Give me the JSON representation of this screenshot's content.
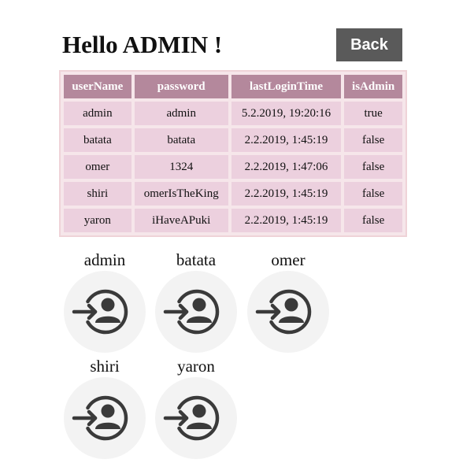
{
  "header": {
    "greeting": "Hello ADMIN !",
    "back_label": "Back"
  },
  "table": {
    "columns": [
      "userName",
      "password",
      "lastLoginTime",
      "isAdmin"
    ],
    "rows": [
      [
        "admin",
        "admin",
        "5.2.2019, 19:20:16",
        "true"
      ],
      [
        "batata",
        "batata",
        "2.2.2019, 1:45:19",
        "false"
      ],
      [
        "omer",
        "1324",
        "2.2.2019, 1:47:06",
        "false"
      ],
      [
        "shiri",
        "omerIsTheKing",
        "2.2.2019, 1:45:19",
        "false"
      ],
      [
        "yaron",
        "iHaveAPuki",
        "2.2.2019, 1:45:19",
        "false"
      ]
    ]
  },
  "tiles": [
    {
      "name": "admin",
      "icon": "login-user-icon"
    },
    {
      "name": "batata",
      "icon": "login-user-icon"
    },
    {
      "name": "omer",
      "icon": "login-user-icon"
    },
    {
      "name": "shiri",
      "icon": "login-user-icon"
    },
    {
      "name": "yaron",
      "icon": "login-user-icon"
    }
  ],
  "colors": {
    "header_cell": "#b4889c",
    "body_cell": "#ecd0de",
    "back_button": "#5a5a5a",
    "tile_circle": "#f3f3f3",
    "icon": "#3a3a3a"
  }
}
